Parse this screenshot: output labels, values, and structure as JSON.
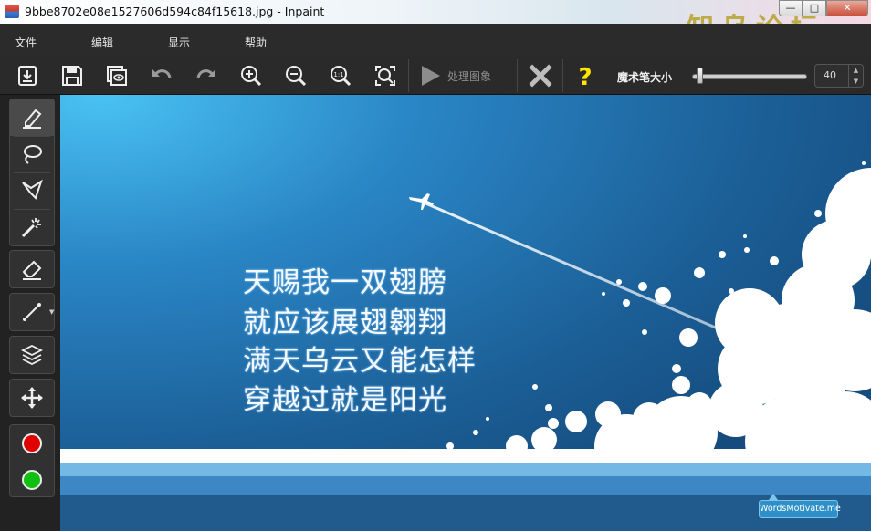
{
  "window": {
    "title": "9bbe8702e08e1527606d594c84f15618.jpg - Inpaint",
    "controls": {
      "minimize": "—",
      "maximize": "□",
      "close": "✕"
    },
    "watermark": "知乌论坛"
  },
  "menu": {
    "items": [
      "文件",
      "编辑",
      "显示",
      "帮助"
    ]
  },
  "toolbar": {
    "buttons": [
      "open-icon",
      "save-icon",
      "preview-icon",
      "undo-icon",
      "redo-icon",
      "zoom-in-icon",
      "zoom-out-icon",
      "actual-size-icon",
      "fit-screen-icon"
    ],
    "process_label": "处理图象",
    "cancel_icon": "cancel-icon",
    "help_icon": "help-icon",
    "brush_size_label": "魔术笔大小",
    "brush_size_value": "40",
    "brush_size_level": 0.03
  },
  "tools": [
    "marker-icon",
    "lasso-icon",
    "polygon-lasso-icon",
    "magic-wand-icon",
    "eraser-icon",
    "line-icon",
    "layers-icon",
    "move-icon"
  ],
  "colors": {
    "red_marker": "#e00000",
    "green_marker": "#10c010",
    "sky": "#2a6fa8"
  },
  "image": {
    "poem": [
      "天赐我一双翅膀",
      "就应该展翅翱翔",
      "满天乌云又能怎样",
      "穿越过就是阳光"
    ],
    "badge": "WordsMotivate.me"
  }
}
